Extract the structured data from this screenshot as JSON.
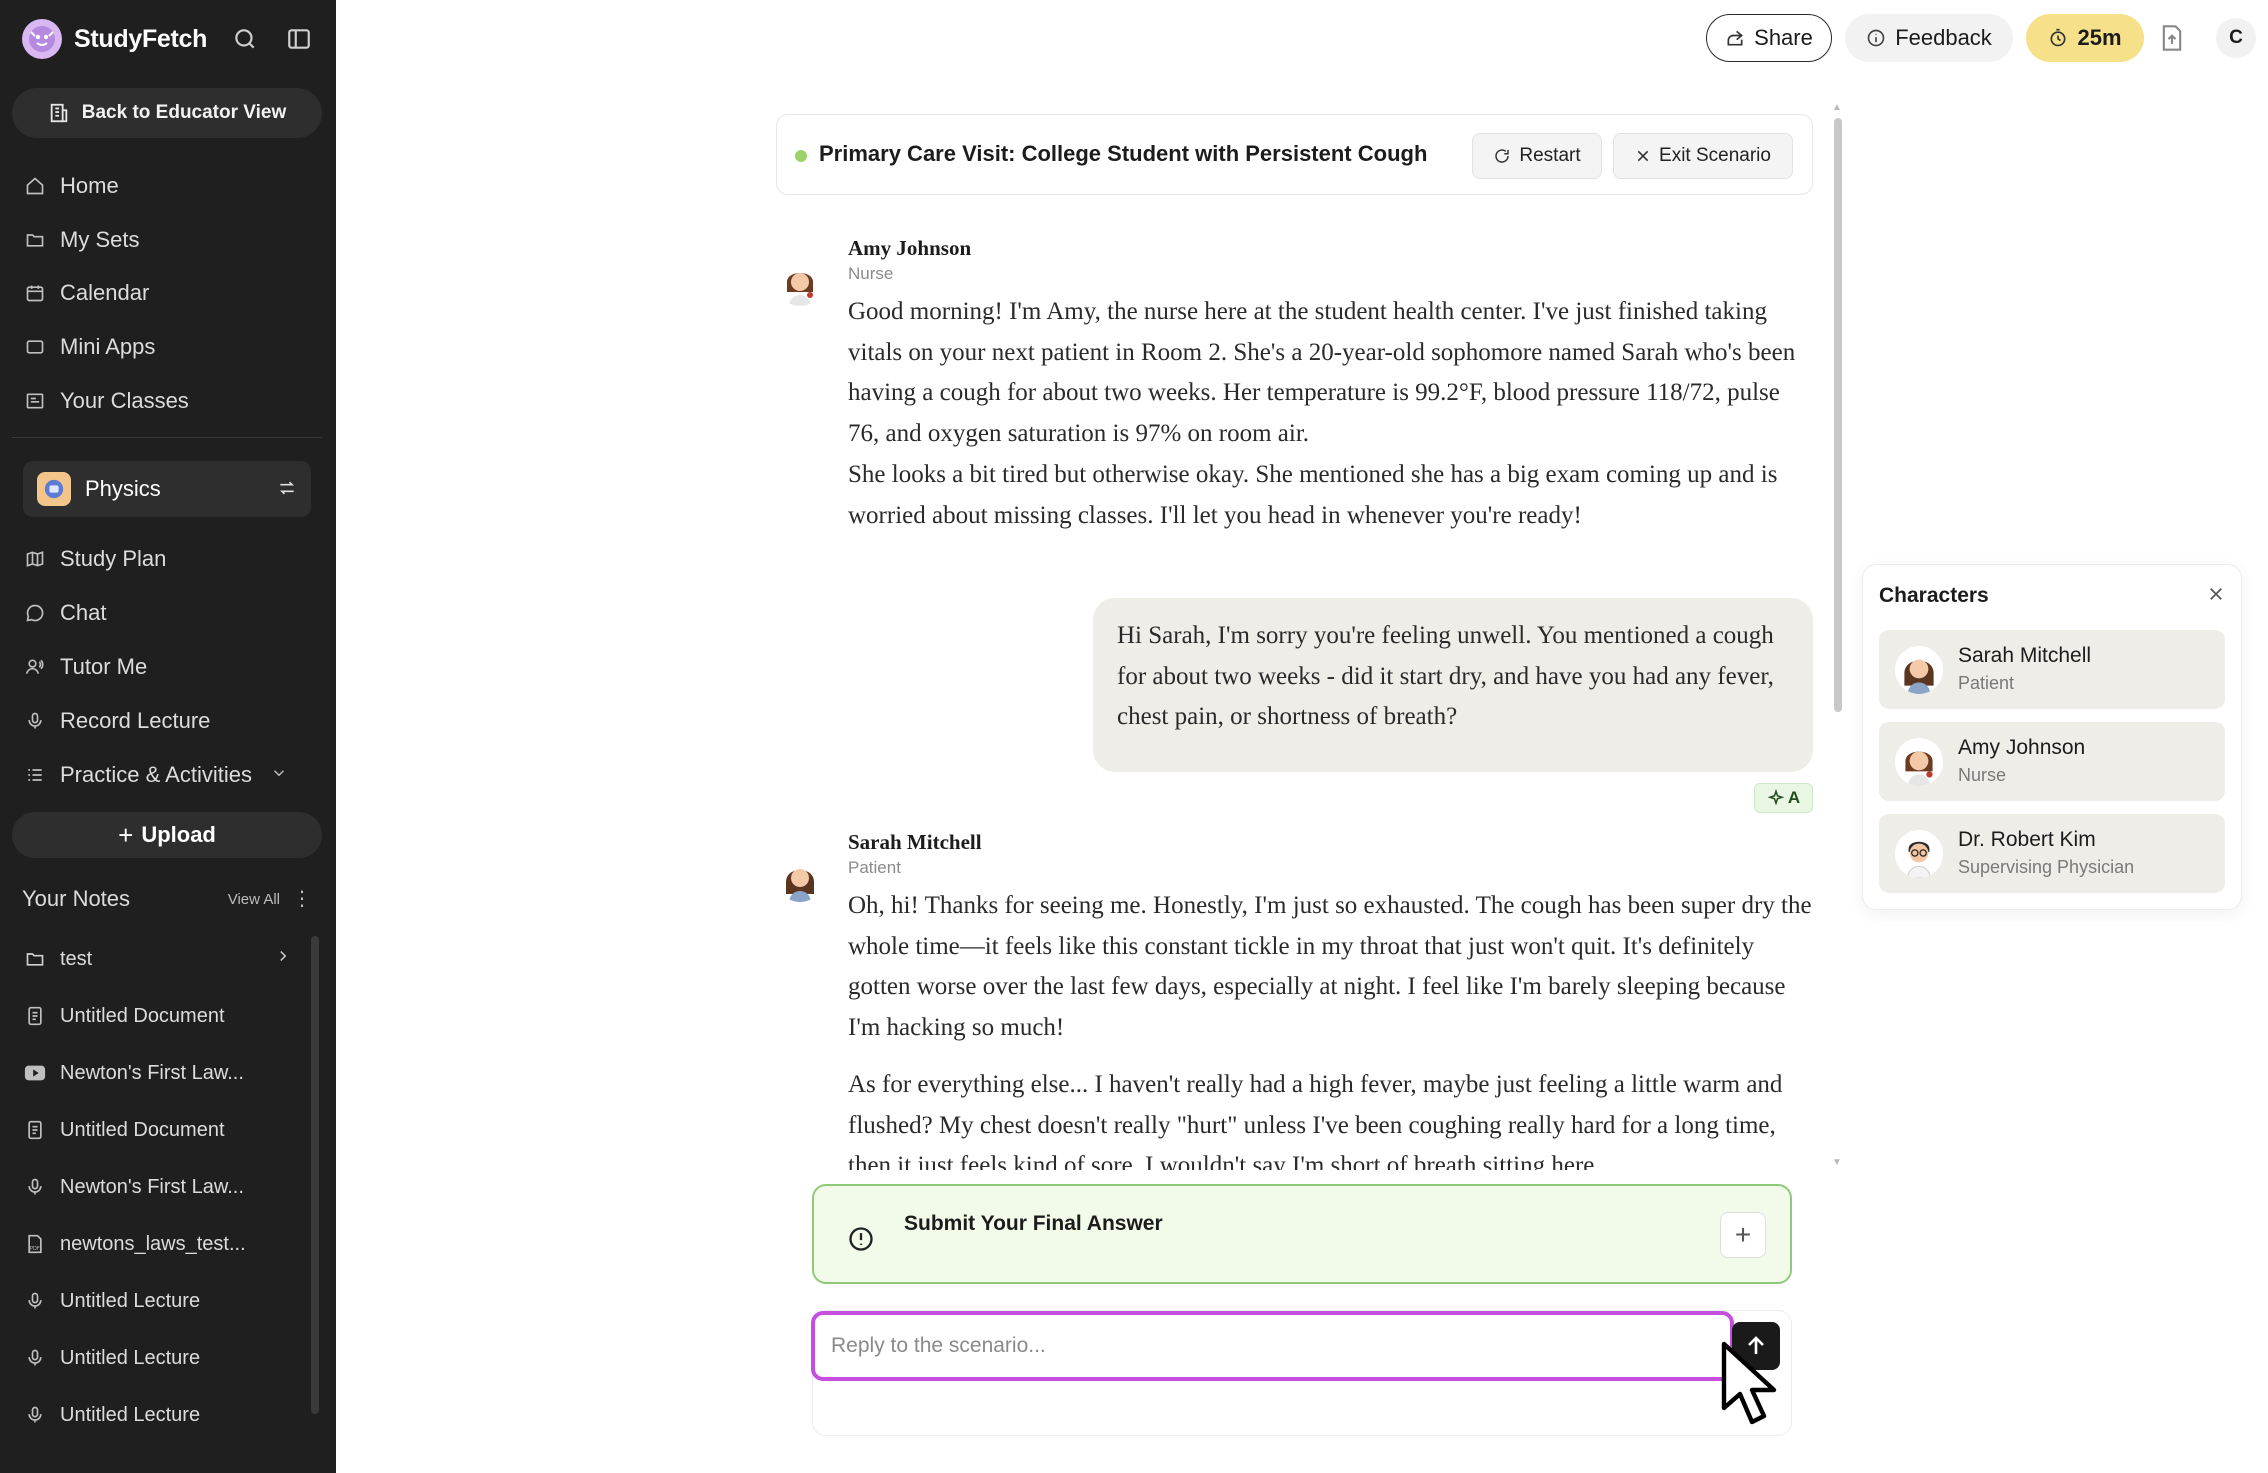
{
  "app": {
    "name": "StudyFetch"
  },
  "sidebar": {
    "back_label": "Back to Educator View",
    "nav": [
      {
        "label": "Home",
        "icon": "home-icon"
      },
      {
        "label": "My Sets",
        "icon": "folder-icon"
      },
      {
        "label": "Calendar",
        "icon": "calendar-icon"
      },
      {
        "label": "Mini Apps",
        "icon": "apps-icon"
      },
      {
        "label": "Your Classes",
        "icon": "classes-icon"
      }
    ],
    "current_class": "Physics",
    "class_nav": [
      {
        "label": "Study Plan",
        "icon": "map-icon"
      },
      {
        "label": "Chat",
        "icon": "chat-icon"
      },
      {
        "label": "Tutor Me",
        "icon": "tutor-icon"
      },
      {
        "label": "Record Lecture",
        "icon": "microphone-icon"
      },
      {
        "label": "Practice & Activities",
        "icon": "list-icon"
      }
    ],
    "upload_label": "Upload",
    "notes_title": "Your Notes",
    "view_all_label": "View All",
    "notes": [
      {
        "label": "test",
        "icon": "folder-icon"
      },
      {
        "label": "Untitled Document",
        "icon": "document-icon"
      },
      {
        "label": "Newton's First Law...",
        "icon": "youtube-icon"
      },
      {
        "label": "Untitled Document",
        "icon": "document-icon"
      },
      {
        "label": "Newton's First Law...",
        "icon": "microphone-icon"
      },
      {
        "label": "newtons_laws_test...",
        "icon": "pdf-icon"
      },
      {
        "label": "Untitled Lecture",
        "icon": "microphone-icon"
      },
      {
        "label": "Untitled Lecture",
        "icon": "microphone-icon"
      },
      {
        "label": "Untitled Lecture",
        "icon": "microphone-icon"
      }
    ]
  },
  "topbar": {
    "share_label": "Share",
    "feedback_label": "Feedback",
    "timer_label": "25m",
    "user_initial": "C"
  },
  "scenario": {
    "title": "Primary Care Visit: College Student with Persistent Cough",
    "restart_label": "Restart",
    "exit_label": "Exit Scenario"
  },
  "messages": [
    {
      "speaker": "Amy Johnson",
      "role": "Nurse",
      "paragraphs": [
        "Good morning! I'm Amy, the nurse here at the student health center. I've just finished taking vitals on your next patient in Room 2. She's a 20-year-old sophomore named Sarah who's been having a cough for about two weeks. Her temperature is 99.2°F, blood pressure 118/72, pulse 76, and oxygen saturation is 97% on room air.",
        "She looks a bit tired but otherwise okay. She mentioned she has a big exam coming up and is worried about missing classes. I'll let you head in whenever you're ready!"
      ]
    },
    {
      "speaker": "You",
      "text": "Hi Sarah, I'm sorry you're feeling unwell. You mentioned a cough for about two weeks - did it start dry, and have you had any fever, chest pain, or shortness of breath?",
      "badge": "A"
    },
    {
      "speaker": "Sarah Mitchell",
      "role": "Patient",
      "paragraphs": [
        "Oh, hi! Thanks for seeing me. Honestly, I'm just so exhausted. The cough has been super dry the whole time—it feels like this constant tickle in my throat that just won't quit. It's definitely gotten worse over the last few days, especially at night. I feel like I'm barely sleeping because I'm hacking so much!",
        "As for everything else... I haven't really had a high fever, maybe just feeling a little warm and flushed? My chest doesn't really \"hurt\" unless I've been coughing really hard for a long time, then it just feels kind of sore. I wouldn't say I'm short of breath sitting here."
      ]
    }
  ],
  "submit": {
    "title": "Submit Your Final Answer"
  },
  "reply": {
    "placeholder": "Reply to the scenario..."
  },
  "characters": {
    "title": "Characters",
    "list": [
      {
        "name": "Sarah Mitchell",
        "role": "Patient"
      },
      {
        "name": "Amy Johnson",
        "role": "Nurse"
      },
      {
        "name": "Dr. Robert Kim",
        "role": "Supervising Physician"
      }
    ]
  },
  "colors": {
    "sidebar_bg": "#1f1f1f",
    "timer_bg": "#f7e08a",
    "scenario_dot": "#9bd36a",
    "submit_border": "#90c97a",
    "reply_focus": "#c64fe0"
  }
}
